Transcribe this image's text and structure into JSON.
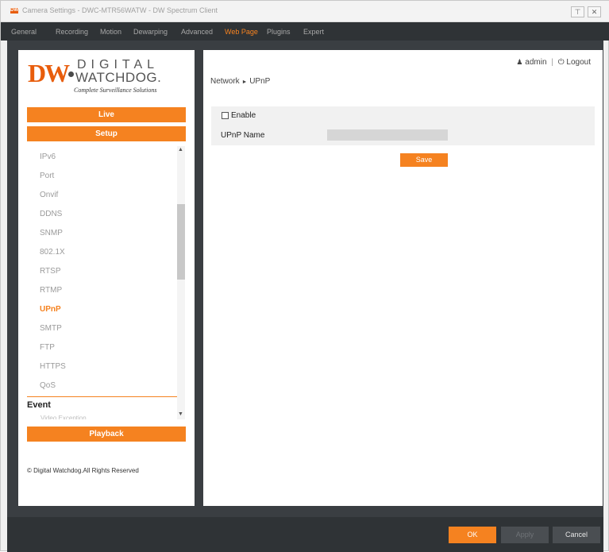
{
  "window": {
    "icon": "DW",
    "title": "Camera Settings - DWC-MTR56WATW - DW Spectrum Client",
    "pin_icon": "pin-icon",
    "close_icon": "close-icon"
  },
  "menu": {
    "items": [
      "General",
      "Recording",
      "Motion",
      "Dewarping",
      "Advanced",
      "Web Page",
      "Plugins",
      "Expert"
    ],
    "active": "Web Page"
  },
  "logo": {
    "mark": "DW",
    "line1": "DIGITAL",
    "line2": "WATCHDOG.",
    "tagline": "Complete Surveillance Solutions"
  },
  "nav": {
    "live": "Live",
    "setup": "Setup",
    "playback": "Playback"
  },
  "submenu": {
    "items": [
      "IPv6",
      "Port",
      "Onvif",
      "DDNS",
      "SNMP",
      "802.1X",
      "RTSP",
      "RTMP",
      "UPnP",
      "SMTP",
      "FTP",
      "HTTPS",
      "QoS"
    ],
    "active": "UPnP"
  },
  "event": {
    "title": "Event",
    "first_sub": "Video Exception"
  },
  "copyright": "© Digital Watchdog.All Rights Reserved",
  "user": {
    "name": "admin",
    "separator": "|",
    "logout": "Logout"
  },
  "breadcrumb": {
    "parent": "Network",
    "separator": "►",
    "current": "UPnP"
  },
  "form": {
    "enable_label": "Enable",
    "enable_checked": false,
    "upnp_name_label": "UPnP Name",
    "upnp_name_value": "",
    "save_label": "Save"
  },
  "footer": {
    "ok": "OK",
    "apply": "Apply",
    "cancel": "Cancel"
  },
  "colors": {
    "accent": "#f58220",
    "menubar": "#2f3336",
    "frame": "#3a3e42"
  }
}
